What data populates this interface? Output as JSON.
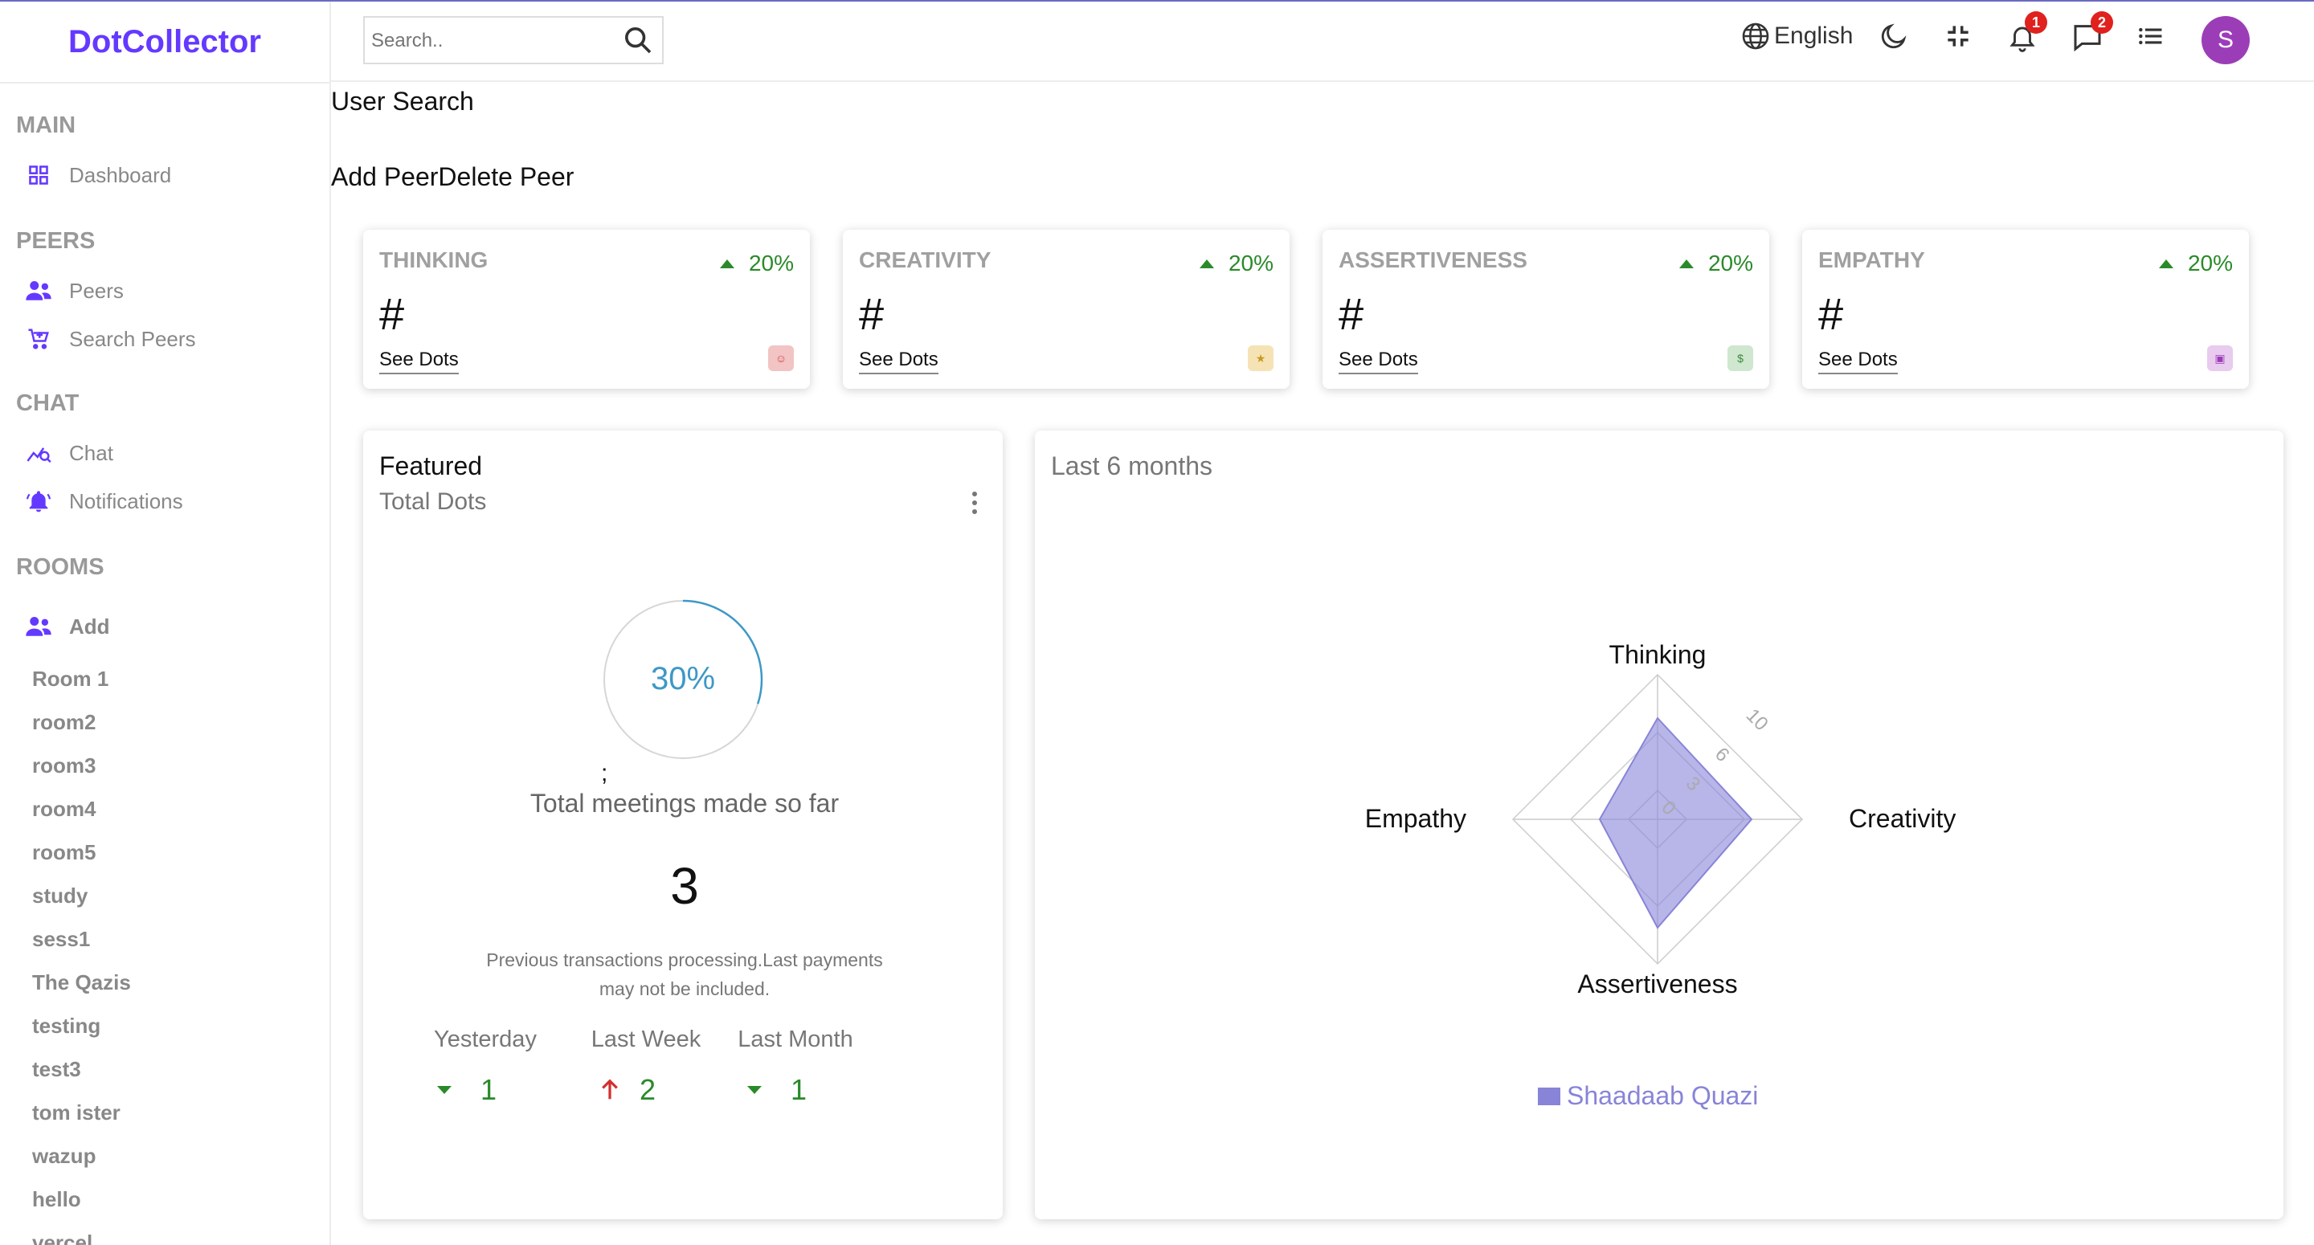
{
  "app": {
    "name": "DotCollector"
  },
  "header": {
    "search_placeholder": "Search..",
    "language": "English",
    "notifications_count": "1",
    "messages_count": "2",
    "avatar_initial": "S"
  },
  "sidebar": {
    "sections": {
      "main": "MAIN",
      "peers": "PEERS",
      "chat": "CHAT",
      "rooms": "ROOMS"
    },
    "items": {
      "dashboard": "Dashboard",
      "peers": "Peers",
      "search_peers": "Search Peers",
      "chat": "Chat",
      "notifications": "Notifications",
      "add": "Add"
    },
    "rooms": [
      "Room 1",
      "room2",
      "room3",
      "room4",
      "room5",
      "study",
      "sess1",
      "The Qazis",
      "testing",
      "test3",
      "tom ister",
      "wazup",
      "hello",
      "vercel"
    ]
  },
  "main": {
    "user_search": "User Search",
    "add_peer": "Add Peer",
    "delete_peer": "Delete Peer"
  },
  "widgets": [
    {
      "title": "THINKING",
      "percent": "20%",
      "count": "#",
      "link": "See Dots",
      "icon": "people-icon",
      "icon_color": "#f2c4c4",
      "icon_fg": "#d24848"
    },
    {
      "title": "CREATIVITY",
      "percent": "20%",
      "count": "#",
      "link": "See Dots",
      "icon": "star-icon",
      "icon_color": "#f6e3b5",
      "icon_fg": "#c79a1d"
    },
    {
      "title": "ASSERTIVENESS",
      "percent": "20%",
      "count": "#",
      "link": "See Dots",
      "icon": "dollar-icon",
      "icon_color": "#cfe6cf",
      "icon_fg": "#3b8a3b"
    },
    {
      "title": "EMPATHY",
      "percent": "20%",
      "count": "#",
      "link": "See Dots",
      "icon": "wallet-icon",
      "icon_color": "#e8cbee",
      "icon_fg": "#9c3db8"
    }
  ],
  "featured": {
    "title": "Featured",
    "subtitle": "Total Dots",
    "progress": 0.3,
    "progress_label": "30%",
    "stray": ";",
    "caption": "Total meetings made so far",
    "total": "3",
    "desc_line1": "Previous transactions processing.Last payments",
    "desc_line2": "may not be included.",
    "summary": [
      {
        "label": "Yesterday",
        "value": "1",
        "trend": "down"
      },
      {
        "label": "Last Week",
        "value": "2",
        "trend": "up"
      },
      {
        "label": "Last Month",
        "value": "1",
        "trend": "down"
      }
    ]
  },
  "chart_data": {
    "type": "radar",
    "title": "Last 6 months",
    "axes": [
      "Thinking",
      "Creativity",
      "Assertiveness",
      "Empathy"
    ],
    "scale_ticks": [
      "0",
      "3",
      "6",
      "10"
    ],
    "rmax": 10,
    "series": [
      {
        "name": "Shaadaab Quazi",
        "values": [
          7,
          6.5,
          7.5,
          4
        ],
        "color": "#8884d8"
      }
    ]
  }
}
